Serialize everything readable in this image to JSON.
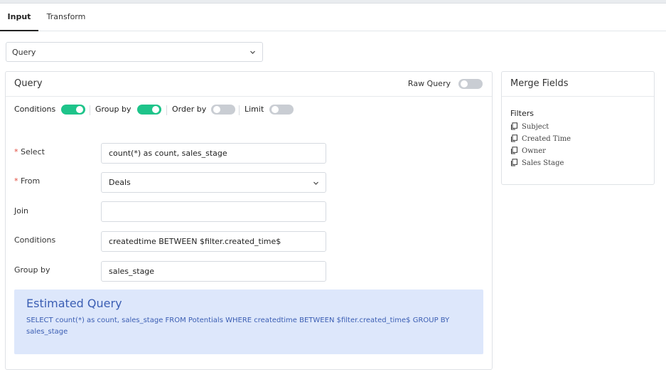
{
  "tabs": [
    "Input",
    "Transform"
  ],
  "source_select": {
    "value": "Query"
  },
  "query_panel": {
    "title": "Query",
    "raw_query_label": "Raw Query",
    "options": [
      {
        "label": "Conditions",
        "on": true
      },
      {
        "label": "Group by",
        "on": true
      },
      {
        "label": "Order by",
        "on": false
      },
      {
        "label": "Limit",
        "on": false
      }
    ],
    "fields": {
      "select": {
        "required_mark": "*",
        "label": "Select",
        "value": "count(*) as count, sales_stage"
      },
      "from": {
        "required_mark": "*",
        "label": "From",
        "value": "Deals"
      },
      "join": {
        "label": "Join",
        "value": ""
      },
      "conditions": {
        "label": "Conditions",
        "value": "createdtime BETWEEN $filter.created_time$"
      },
      "group_by": {
        "label": "Group by",
        "value": "sales_stage"
      }
    },
    "estimated": {
      "title": "Estimated Query",
      "sql": "SELECT count(*) as count, sales_stage FROM Potentials WHERE createdtime BETWEEN $filter.created_time$ GROUP BY sales_stage"
    }
  },
  "merge_fields": {
    "title": "Merge Fields",
    "group_label": "Filters",
    "items": [
      "Subject",
      "Created Time",
      "Owner",
      "Sales Stage"
    ]
  },
  "colors": {
    "toggle_on": "#1ec48a",
    "toggle_off": "#c9cdd3",
    "estimated_bg": "#dde7fb",
    "estimated_text": "#3b5eb3",
    "required": "#e04b3d"
  }
}
